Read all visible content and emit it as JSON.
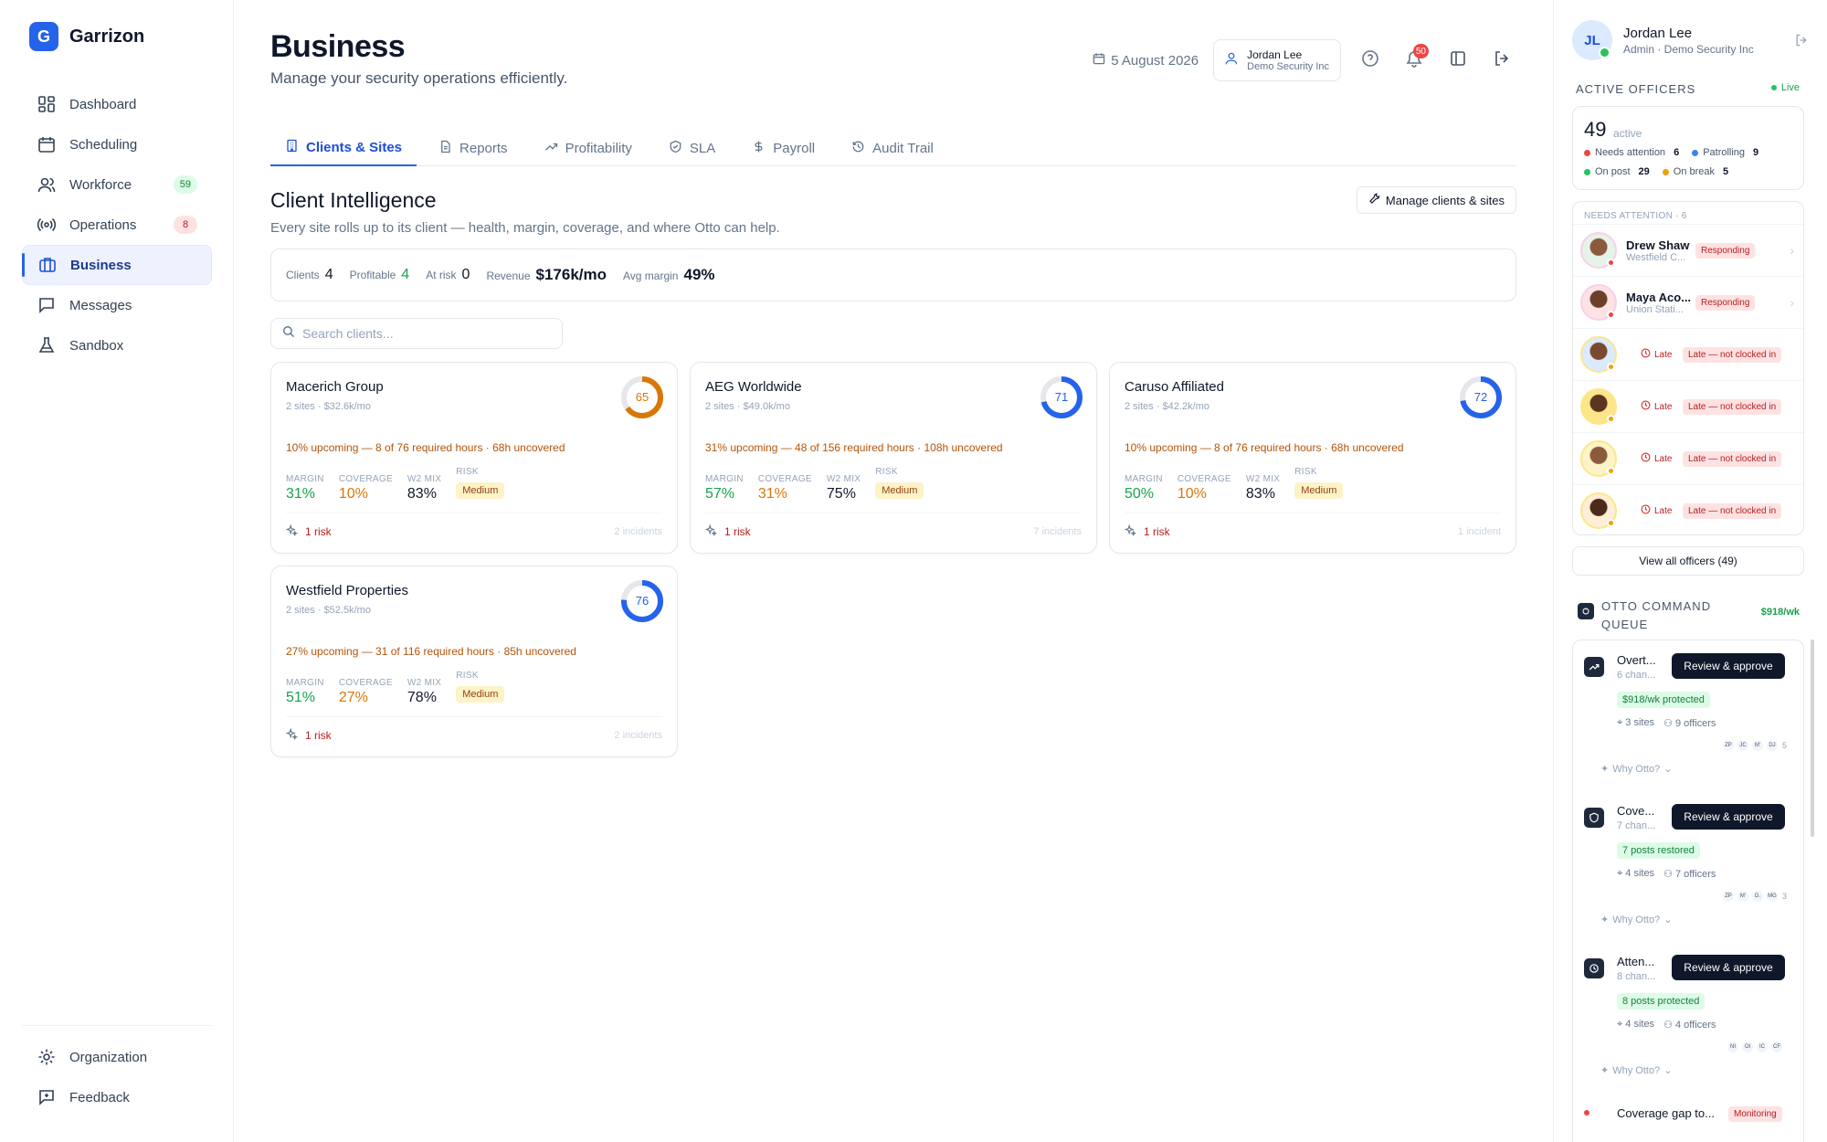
{
  "brand": {
    "logo_letter": "G",
    "name": "Garrizon"
  },
  "nav": {
    "items": [
      {
        "label": "Dashboard",
        "icon": "grid-icon"
      },
      {
        "label": "Scheduling",
        "icon": "calendar-icon"
      },
      {
        "label": "Workforce",
        "icon": "users-icon",
        "badge": "59"
      },
      {
        "label": "Operations",
        "icon": "broadcast-icon",
        "badge": "8"
      },
      {
        "label": "Business",
        "icon": "briefcase-icon",
        "active": true
      },
      {
        "label": "Messages",
        "icon": "message-icon"
      },
      {
        "label": "Sandbox",
        "icon": "flask-icon"
      }
    ],
    "bottom": [
      {
        "label": "Organization",
        "icon": "gear-icon"
      },
      {
        "label": "Feedback",
        "icon": "feedback-icon"
      }
    ]
  },
  "header": {
    "title": "Business",
    "subtitle": "Manage your security operations efficiently.",
    "date": "5 August 2026",
    "user_name": "Jordan Lee",
    "user_org": "Demo Security Inc",
    "notif_count": "50"
  },
  "tabs": [
    {
      "label": "Clients & Sites",
      "icon": "building-icon",
      "active": true
    },
    {
      "label": "Reports",
      "icon": "file-icon"
    },
    {
      "label": "Profitability",
      "icon": "trending-up-icon"
    },
    {
      "label": "SLA",
      "icon": "shield-icon"
    },
    {
      "label": "Payroll",
      "icon": "dollar-icon"
    },
    {
      "label": "Audit Trail",
      "icon": "history-icon"
    }
  ],
  "client_intel": {
    "title": "Client Intelligence",
    "subtitle": "Every site rolls up to its client — health, margin, coverage, and where Otto can help.",
    "manage_label": "Manage clients & sites",
    "stats": {
      "clients_label": "Clients",
      "clients": "4",
      "profitable_label": "Profitable",
      "profitable": "4",
      "atrisk_label": "At risk",
      "atrisk": "0",
      "revenue_label": "Revenue",
      "revenue": "$176k/mo",
      "margin_label": "Avg margin",
      "margin": "49%"
    },
    "search_placeholder": "Search clients..."
  },
  "metric_labels": {
    "margin": "MARGIN",
    "coverage": "COVERAGE",
    "w2": "W2 MIX",
    "risk": "RISK"
  },
  "clients": [
    {
      "name": "Macerich Group",
      "sub": "2 sites · $32.6k/mo",
      "score": 65,
      "score_color": "#d97706",
      "upcoming": "10% upcoming — 8 of 76 required hours · 68h uncovered",
      "margin": "31%",
      "coverage": "10%",
      "w2": "83%",
      "risk": "Medium",
      "risks": "1 risk",
      "incidents": "2 incidents"
    },
    {
      "name": "AEG Worldwide",
      "sub": "2 sites · $49.0k/mo",
      "score": 71,
      "score_color": "#2563eb",
      "upcoming": "31% upcoming — 48 of 156 required hours · 108h uncovered",
      "margin": "57%",
      "coverage": "31%",
      "w2": "75%",
      "risk": "Medium",
      "risks": "1 risk",
      "incidents": "7 incidents"
    },
    {
      "name": "Caruso Affiliated",
      "sub": "2 sites · $42.2k/mo",
      "score": 72,
      "score_color": "#2563eb",
      "upcoming": "10% upcoming — 8 of 76 required hours · 68h uncovered",
      "margin": "50%",
      "coverage": "10%",
      "w2": "83%",
      "risk": "Medium",
      "risks": "1 risk",
      "incidents": "1 incident"
    },
    {
      "name": "Westfield Properties",
      "sub": "2 sites · $52.5k/mo",
      "score": 76,
      "score_color": "#2563eb",
      "upcoming": "27% upcoming — 31 of 116 required hours · 85h uncovered",
      "margin": "51%",
      "coverage": "27%",
      "w2": "78%",
      "risk": "Medium",
      "risks": "1 risk",
      "incidents": "2 incidents"
    }
  ],
  "right_panel": {
    "initials": "JL",
    "user_name": "Jordan Lee",
    "user_role": "Admin · Demo Security Inc",
    "active_title": "ACTIVE OFFICERS",
    "live": "Live",
    "active_count": "49",
    "active_label": "active",
    "needs_attention_label": "Needs attention",
    "needs_attention": "6",
    "patrolling_label": "Patrolling",
    "patrolling": "9",
    "onpost_label": "On post",
    "onpost": "29",
    "onbreak_label": "On break",
    "onbreak": "5",
    "na_header": "NEEDS ATTENTION · 6",
    "officers": [
      {
        "name": "Drew Shaw",
        "site": "Westfield C...",
        "status": "Responding"
      },
      {
        "name": "Maya Aco...",
        "site": "Union Stati...",
        "status": "Responding"
      },
      {
        "late": "Late",
        "status": "Late — not clocked in"
      },
      {
        "late": "Late",
        "status": "Late — not clocked in"
      },
      {
        "late": "Late",
        "status": "Late — not clocked in"
      },
      {
        "late": "Late",
        "status": "Late — not clocked in"
      }
    ],
    "view_all": "View all officers (49)",
    "queue_title": "OTTO COMMAND QUEUE",
    "queue_amount": "$918/wk",
    "queue": [
      {
        "title": "Overt...",
        "sub": "6 chan...",
        "action": "Review & approve",
        "protected": "$918/wk protected",
        "sites": "3 sites",
        "officers": "9 officers",
        "avatars": [
          "ZP",
          "JC",
          "M'",
          "DJ"
        ],
        "more": "5",
        "why": "Why Otto?"
      },
      {
        "title": "Cove...",
        "sub": "7 chan...",
        "action": "Review & approve",
        "protected": "7 posts restored",
        "sites": "4 sites",
        "officers": "7 officers",
        "avatars": [
          "ZP",
          "M'",
          "D.",
          "MG"
        ],
        "more": "3",
        "why": "Why Otto?"
      },
      {
        "title": "Atten...",
        "sub": "8 chan...",
        "action": "Review & approve",
        "protected": "8 posts protected",
        "sites": "4 sites",
        "officers": "4 officers",
        "avatars": [
          "NI",
          "OI",
          "IC",
          "CF"
        ],
        "more": "",
        "why": "Why Otto?"
      }
    ],
    "queue_last": {
      "title": "Coverage gap to...",
      "status": "Monitoring"
    }
  }
}
